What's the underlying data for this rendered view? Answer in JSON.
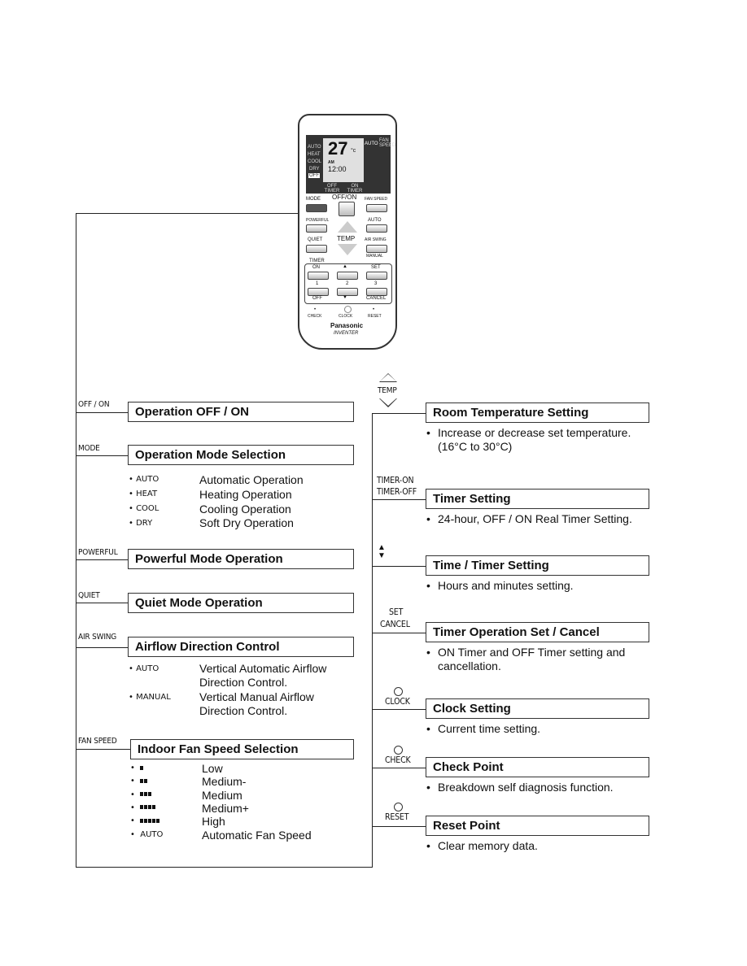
{
  "remote": {
    "display": {
      "modes": [
        "AUTO",
        "HEAT",
        "COOL",
        "DRY",
        "OFF"
      ],
      "temp": "27",
      "unit": "°c",
      "fan_auto": "AUTO",
      "fan_speed": "FAN SPEED",
      "am": "AM",
      "clock": "12:00",
      "off_timer": "OFF TIMER",
      "on_timer": "ON TIMER"
    },
    "buttons": {
      "offon": "OFF/ON",
      "mode": "MODE",
      "fan_speed": "FAN SPEED",
      "powerful": "POWERFUL",
      "quiet": "QUIET",
      "temp": "TEMP",
      "auto": "AUTO",
      "air_swing": "AIR SWING",
      "manual": "MANUAL",
      "timer": "TIMER",
      "on": "ON",
      "set": "SET",
      "one": "1",
      "two": "2",
      "three": "3",
      "off": "OFF",
      "cancel": "CANCEL",
      "check": "CHECK",
      "clock": "CLOCK",
      "reset": "RESET"
    },
    "brand": "Panasonic",
    "model": "INVENTER"
  },
  "left": [
    {
      "tag": "OFF / ON",
      "title": "Operation OFF / ON"
    },
    {
      "tag": "MODE",
      "title": "Operation Mode Selection",
      "items": [
        {
          "code": "AUTO",
          "desc": "Automatic Operation"
        },
        {
          "code": "HEAT",
          "desc": "Heating Operation"
        },
        {
          "code": "COOL",
          "desc": "Cooling Operation"
        },
        {
          "code": "DRY",
          "desc": "Soft Dry Operation"
        }
      ]
    },
    {
      "tag": "POWERFUL",
      "title": "Powerful Mode Operation"
    },
    {
      "tag": "QUIET",
      "title": "Quiet Mode Operation"
    },
    {
      "tag": "AIR SWING",
      "title": "Airflow Direction Control",
      "items": [
        {
          "code": "AUTO",
          "desc": "Vertical Automatic Airflow Direction Control."
        },
        {
          "code": "MANUAL",
          "desc": "Vertical Manual Airflow Direction Control."
        }
      ]
    },
    {
      "tag": "FAN SPEED",
      "title": "Indoor Fan Speed Selection",
      "items": [
        {
          "bars": 1,
          "desc": "Low"
        },
        {
          "bars": 2,
          "desc": "Medium-"
        },
        {
          "bars": 3,
          "desc": "Medium"
        },
        {
          "bars": 4,
          "desc": "Medium+"
        },
        {
          "bars": 5,
          "desc": "High"
        },
        {
          "code": "AUTO",
          "desc": "Automatic Fan Speed"
        }
      ]
    }
  ],
  "right": [
    {
      "tag": "TEMP",
      "title": "Room Temperature Setting",
      "desc": "Increase or decrease set temperature. (16°C to 30°C)"
    },
    {
      "tag1": "TIMER-ON",
      "tag2": "TIMER-OFF",
      "title": "Timer Setting",
      "desc": "24-hour, OFF / ON Real Timer Setting."
    },
    {
      "title": "Time / Timer Setting",
      "desc": "Hours and minutes setting."
    },
    {
      "tag1": "SET",
      "tag2": "CANCEL",
      "title": "Timer Operation Set / Cancel",
      "desc": "ON Timer and OFF Timer setting and cancellation."
    },
    {
      "tag": "CLOCK",
      "title": "Clock Setting",
      "desc": "Current time setting."
    },
    {
      "tag": "CHECK",
      "title": "Check Point",
      "desc": "Breakdown self diagnosis function."
    },
    {
      "tag": "RESET",
      "title": "Reset Point",
      "desc": "Clear memory data."
    }
  ]
}
